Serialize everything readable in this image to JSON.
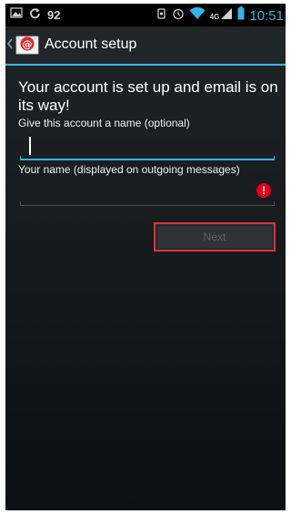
{
  "status_bar": {
    "notification_count": "92",
    "network_label": "4G",
    "time": "10:51",
    "icons": [
      "picture-icon",
      "sync-icon",
      "settings-sync-icon",
      "alarm-icon",
      "wifi-icon",
      "signal-icon",
      "battery-icon"
    ]
  },
  "action_bar": {
    "title": "Account setup",
    "icons": [
      "back-caret-icon",
      "mail-app-icon"
    ]
  },
  "content": {
    "headline": "Your account is set up and email is on its way!",
    "account_name_label": "Give this account a name (optional)",
    "account_name_value": "",
    "your_name_label": "Your name (displayed on outgoing messages)",
    "your_name_value": "",
    "error_icon": "error-icon"
  },
  "buttons": {
    "next_label": "Next"
  },
  "colors": {
    "accent": "#33b5e5",
    "error": "#e3001b",
    "highlight_border": "#e0303a"
  }
}
